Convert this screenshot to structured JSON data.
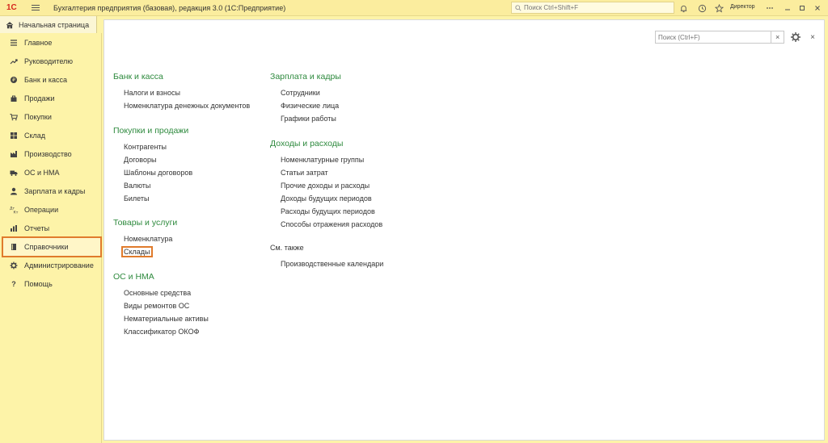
{
  "titlebar": {
    "logo": "1С",
    "title": "Бухгалтерия предприятия (базовая), редакция 3.0  (1С:Предприятие)",
    "search_placeholder": "Поиск Ctrl+Shift+F",
    "user": "Директор"
  },
  "home_tab": {
    "label": "Начальная страница"
  },
  "sidebar": {
    "items": [
      {
        "label": "Главное",
        "icon": "menu-list-icon"
      },
      {
        "label": "Руководителю",
        "icon": "trend-icon"
      },
      {
        "label": "Банк и касса",
        "icon": "coin-icon"
      },
      {
        "label": "Продажи",
        "icon": "bag-icon"
      },
      {
        "label": "Покупки",
        "icon": "cart-icon"
      },
      {
        "label": "Склад",
        "icon": "warehouse-icon"
      },
      {
        "label": "Производство",
        "icon": "factory-icon"
      },
      {
        "label": "ОС и НМА",
        "icon": "truck-icon"
      },
      {
        "label": "Зарплата и кадры",
        "icon": "person-icon"
      },
      {
        "label": "Операции",
        "icon": "dt-kt-icon"
      },
      {
        "label": "Отчеты",
        "icon": "chart-icon"
      },
      {
        "label": "Справочники",
        "icon": "book-icon"
      },
      {
        "label": "Администрирование",
        "icon": "gear-icon"
      },
      {
        "label": "Помощь",
        "icon": "question-icon"
      }
    ],
    "selected": "Справочники"
  },
  "panel": {
    "search_placeholder": "Поиск (Ctrl+F)",
    "col1": {
      "sections": [
        {
          "title": "Банк и касса",
          "links": [
            "Налоги и взносы",
            "Номенклатура денежных документов"
          ]
        },
        {
          "title": "Покупки и продажи",
          "links": [
            "Контрагенты",
            "Договоры",
            "Шаблоны договоров",
            "Валюты",
            "Билеты"
          ]
        },
        {
          "title": "Товары и услуги",
          "links": [
            "Номенклатура",
            "Склады"
          ]
        },
        {
          "title": "ОС и НМА",
          "links": [
            "Основные средства",
            "Виды ремонтов ОС",
            "Нематериальные активы",
            "Классификатор ОКОФ"
          ]
        }
      ]
    },
    "col2": {
      "sections": [
        {
          "title": "Зарплата и кадры",
          "links": [
            "Сотрудники",
            "Физические лица",
            "Графики работы"
          ]
        },
        {
          "title": "Доходы и расходы",
          "links": [
            "Номенклатурные группы",
            "Статьи затрат",
            "Прочие доходы и расходы",
            "Доходы будущих периодов",
            "Расходы будущих периодов",
            "Способы отражения расходов"
          ]
        }
      ],
      "see_also": {
        "title": "См. также",
        "links": [
          "Производственные календари"
        ]
      }
    },
    "highlighted_link": "Склады"
  },
  "colors": {
    "section_title": "#2e8a3e",
    "highlight": "#e07b2c",
    "sidebar_bg": "#fdf3a8"
  }
}
